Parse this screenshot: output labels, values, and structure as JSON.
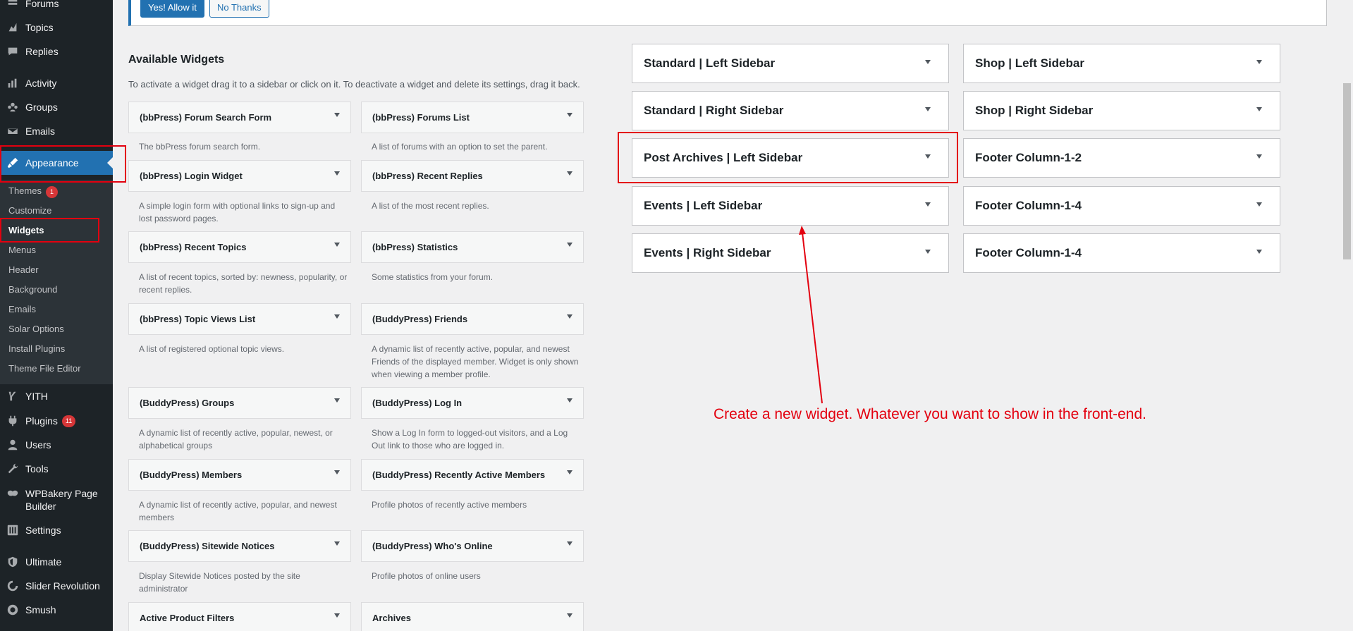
{
  "admin_menu": {
    "items": [
      {
        "label": "Forums",
        "icon": "forums-icon"
      },
      {
        "label": "Topics",
        "icon": "topics-icon"
      },
      {
        "label": "Replies",
        "icon": "replies-icon"
      },
      {
        "label": "Activity",
        "icon": "activity-icon"
      },
      {
        "label": "Groups",
        "icon": "groups-icon"
      },
      {
        "label": "Emails",
        "icon": "emails-icon"
      },
      {
        "label": "Appearance",
        "icon": "appearance-icon"
      },
      {
        "label": "YITH",
        "icon": "yith-icon"
      },
      {
        "label": "Plugins",
        "icon": "plugins-icon",
        "badge": "11"
      },
      {
        "label": "Users",
        "icon": "users-icon"
      },
      {
        "label": "Tools",
        "icon": "tools-icon"
      },
      {
        "label": "WPBakery Page Builder",
        "icon": "wpbakery-icon"
      },
      {
        "label": "Settings",
        "icon": "settings-icon"
      },
      {
        "label": "Ultimate",
        "icon": "ultimate-icon"
      },
      {
        "label": "Slider Revolution",
        "icon": "slider-revolution-icon"
      },
      {
        "label": "Smush",
        "icon": "smush-icon"
      }
    ],
    "appearance_submenu": [
      {
        "label": "Themes",
        "badge": "1"
      },
      {
        "label": "Customize"
      },
      {
        "label": "Widgets"
      },
      {
        "label": "Menus"
      },
      {
        "label": "Header"
      },
      {
        "label": "Background"
      },
      {
        "label": "Emails"
      },
      {
        "label": "Solar Options"
      },
      {
        "label": "Install Plugins"
      },
      {
        "label": "Theme File Editor"
      }
    ],
    "wpbakery_line1": "WPBakery Page",
    "wpbakery_line2": "Builder"
  },
  "notice": {
    "allow_label": "Yes! Allow it",
    "deny_label": "No Thanks"
  },
  "available_widgets": {
    "title": "Available Widgets",
    "description": "To activate a widget drag it to a sidebar or click on it. To deactivate a widget and delete its settings, drag it back.",
    "widgets": [
      {
        "title": "(bbPress) Forum Search Form",
        "desc": "The bbPress forum search form."
      },
      {
        "title": "(bbPress) Forums List",
        "desc": "A list of forums with an option to set the parent."
      },
      {
        "title": "(bbPress) Login Widget",
        "desc": "A simple login form with optional links to sign-up and lost password pages."
      },
      {
        "title": "(bbPress) Recent Replies",
        "desc": "A list of the most recent replies."
      },
      {
        "title": "(bbPress) Recent Topics",
        "desc": "A list of recent topics, sorted by: newness, popularity, or recent replies."
      },
      {
        "title": "(bbPress) Statistics",
        "desc": "Some statistics from your forum."
      },
      {
        "title": "(bbPress) Topic Views List",
        "desc": "A list of registered optional topic views."
      },
      {
        "title": "(BuddyPress) Friends",
        "desc": "A dynamic list of recently active, popular, and newest Friends of the displayed member. Widget is only shown when viewing a member profile."
      },
      {
        "title": "(BuddyPress) Groups",
        "desc": "A dynamic list of recently active, popular, newest, or alphabetical groups"
      },
      {
        "title": "(BuddyPress) Log In",
        "desc": "Show a Log In form to logged-out visitors, and a Log Out link to those who are logged in."
      },
      {
        "title": "(BuddyPress) Members",
        "desc": "A dynamic list of recently active, popular, and newest members"
      },
      {
        "title": "(BuddyPress) Recently Active Members",
        "desc": "Profile photos of recently active members"
      },
      {
        "title": "(BuddyPress) Sitewide Notices",
        "desc": "Display Sitewide Notices posted by the site administrator"
      },
      {
        "title": "(BuddyPress) Who's Online",
        "desc": "Profile photos of online users"
      },
      {
        "title": "Active Product Filters",
        "desc": ""
      },
      {
        "title": "Archives",
        "desc": ""
      }
    ]
  },
  "sidebars": [
    {
      "title": "Standard | Left Sidebar"
    },
    {
      "title": "Shop | Left Sidebar"
    },
    {
      "title": "Standard | Right Sidebar"
    },
    {
      "title": "Shop | Right Sidebar"
    },
    {
      "title": "Post Archives | Left Sidebar"
    },
    {
      "title": "Footer Column-1-2"
    },
    {
      "title": "Events | Left Sidebar"
    },
    {
      "title": "Footer Column-1-4"
    },
    {
      "title": "Events | Right Sidebar"
    },
    {
      "title": "Footer Column-1-4"
    }
  ],
  "annotation": {
    "text": "Create a new widget. Whatever you want to show in the front-end.",
    "color": "#e3000f"
  },
  "colors": {
    "accent": "#2271b1",
    "sidebar_bg": "#1d2327",
    "badge": "#d63638"
  }
}
